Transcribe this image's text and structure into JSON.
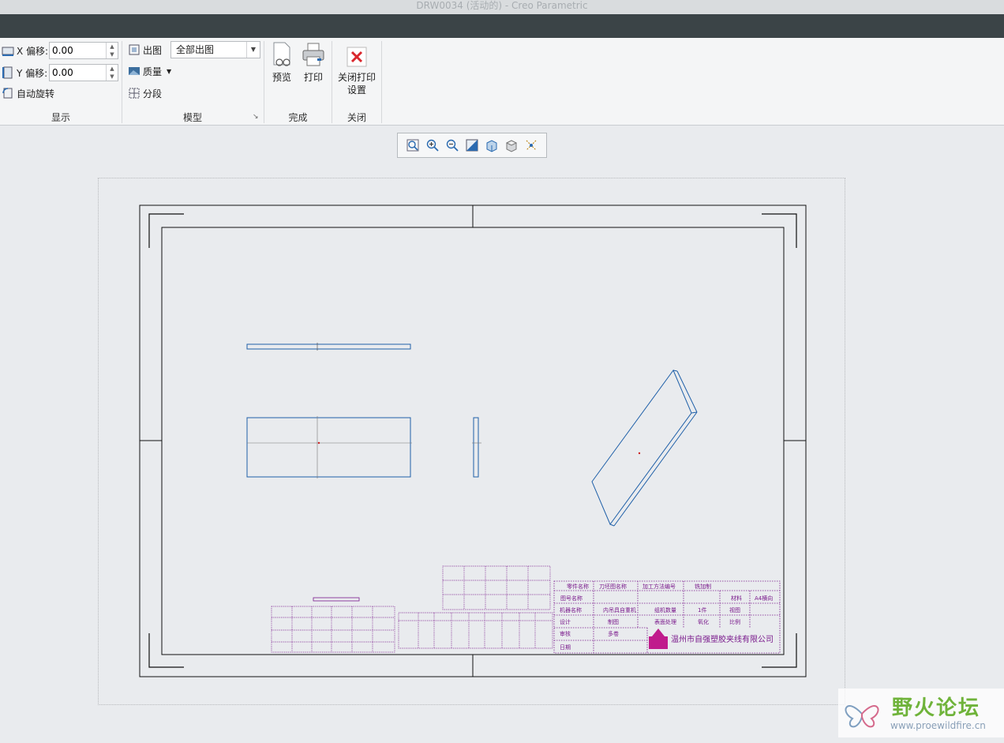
{
  "window": {
    "title": "DRW0034 (活动的) - Creo Parametric"
  },
  "display_group": {
    "label": "显示",
    "x_offset_label": "X 偏移:",
    "x_offset_value": "0.00",
    "y_offset_label": "Y 偏移:",
    "y_offset_value": "0.00",
    "auto_rotate_label": "自动旋转"
  },
  "model_group": {
    "label": "模型",
    "output_label": "出图",
    "output_select_value": "全部出图",
    "quality_label": "质量",
    "segment_label": "分段"
  },
  "finish_group": {
    "label": "完成",
    "preview_label": "预览",
    "print_label": "打印"
  },
  "close_group": {
    "label": "关闭",
    "close_print_line1": "关闭打印",
    "close_print_line2": "设置"
  },
  "title_block": {
    "company": "温州市自强塑胶夹线有限公司",
    "cells": [
      "零件名称",
      "刀坯图名称",
      "加工方法编号",
      "铣加制",
      "图号名称",
      "材料",
      "A4横向",
      "机器名称",
      "内吊具自重机",
      "组机数量",
      "1件",
      "视图",
      "设计",
      "制图",
      "表面处理",
      "氧化",
      "比例",
      "审核",
      "多卷",
      "日期"
    ]
  },
  "watermark": {
    "text": "野火论坛",
    "url": "www.proewildfire.cn"
  },
  "colors": {
    "title_bar": "#d9dcde",
    "dark_bar": "#3b4447",
    "ribbon": "#f4f5f6",
    "canvas": "#e9ebee",
    "model_lines": "#1e5fa8",
    "table_lines": "#7a1a8c",
    "close_icon": "#d9262c",
    "watermark_green": "#6fb33a"
  }
}
